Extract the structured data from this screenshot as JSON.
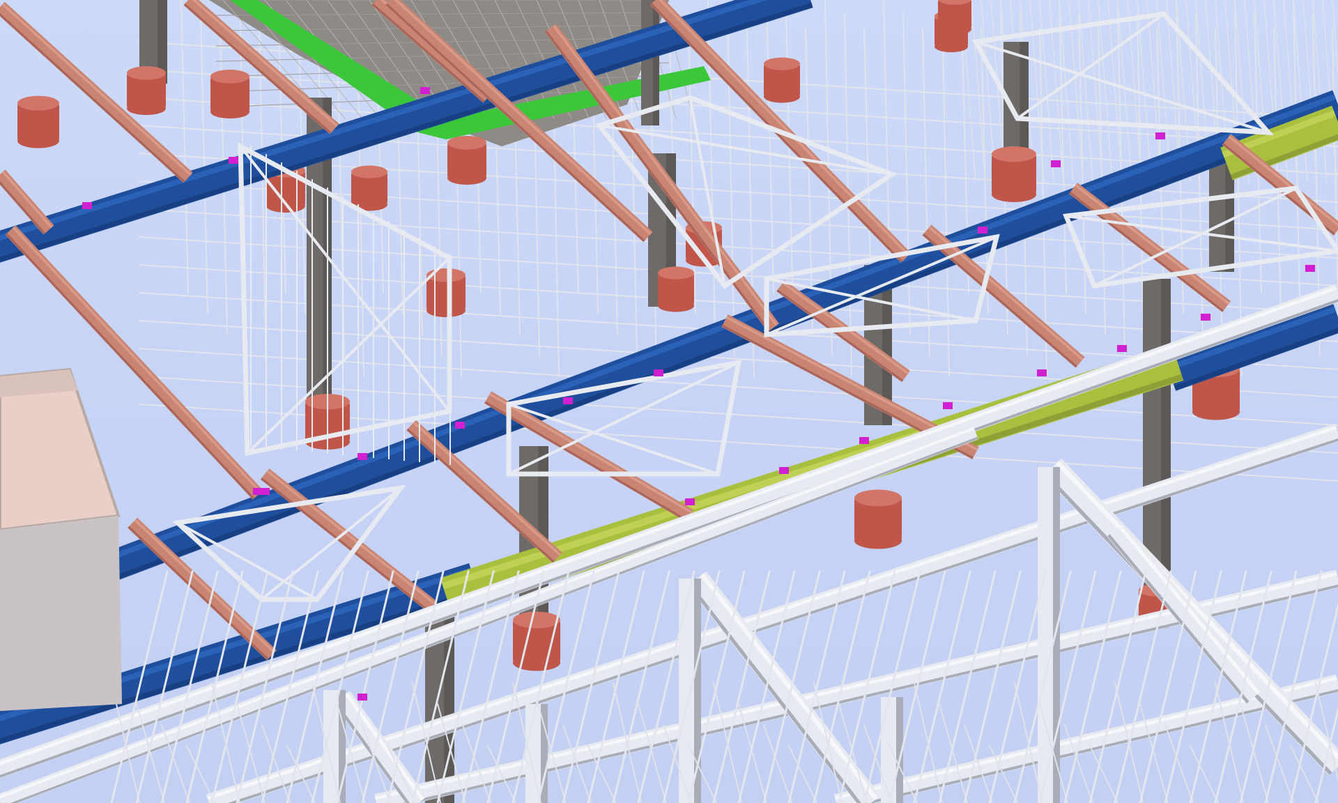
{
  "viewport": {
    "type": "3D BIM model viewport",
    "background": "#c9d6f7"
  },
  "colors": {
    "primary_beam": "#1f4e9c",
    "primary_beam_highlight": "#2a62b8",
    "primary_beam_shadow": "#183f82",
    "selected_beam": "#a9bf3e",
    "selected_beam_highlight": "#bfd055",
    "rafter": "#c98472",
    "rafter_shadow": "#a9655a",
    "pipe": "#3cc73a",
    "column": "#6e6a68",
    "footing": "#c0564a",
    "steel": "#e7eaf0",
    "steel_shadow": "#a8adb8",
    "bracket": "#d21fd1",
    "wall_block": "#e9cfc7",
    "wall_block_side": "#c9c3c6",
    "deck": "#8e8a86"
  },
  "labels": []
}
